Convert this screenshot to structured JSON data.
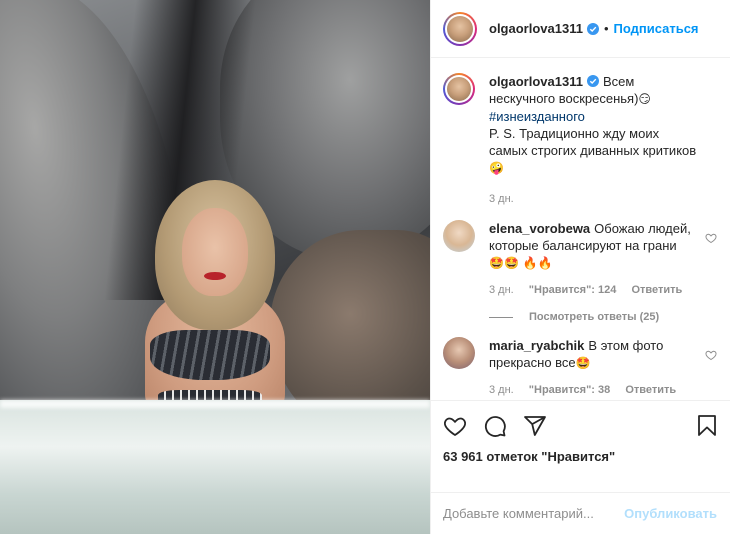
{
  "header": {
    "username": "olgaorlova1311",
    "dot": "•",
    "follow_label": "Подписаться"
  },
  "caption": {
    "username": "olgaorlova1311",
    "text_before": "Всем нескучного воскресенья)",
    "emoji1": "😏",
    "hashtag": "#изнеизданного",
    "text_after": "P. S. Традиционно жду моих самых строгих диванных критиков",
    "emoji2": "🤪",
    "time": "3 дн."
  },
  "comments": [
    {
      "username": "elena_vorobewa",
      "text": "Обожаю людей, которые балансируют на грани",
      "emojis": "🤩🤩 🔥🔥",
      "time": "3 дн.",
      "likes_label": "\"Нравится\": 124",
      "reply_label": "Ответить",
      "view_replies": "Посмотреть ответы (25)"
    },
    {
      "username": "maria_ryabchik",
      "text": "В этом фото прекрасно все",
      "emojis": "🤩",
      "time": "3 дн.",
      "likes_label": "\"Нравится\": 38",
      "reply_label": "Ответить"
    }
  ],
  "actions": {
    "icons": [
      "heart-icon",
      "comment-icon",
      "share-icon",
      "bookmark-icon"
    ],
    "likes_count": "63 961 отметок \"Нравится\""
  },
  "add_comment": {
    "placeholder": "Добавьте комментарий...",
    "publish_label": "Опубликовать"
  },
  "colors": {
    "accent": "#0095f6",
    "publish_disabled": "#b2dffc",
    "muted": "#8e8e8e",
    "hashtag": "#00376b"
  }
}
